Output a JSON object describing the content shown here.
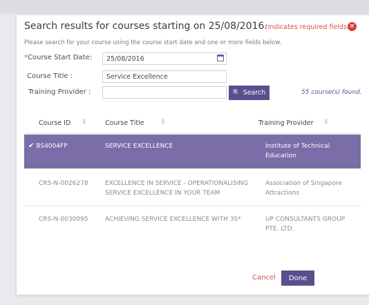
{
  "dialog": {
    "title": "Search results for courses starting on 25/08/2016.",
    "required_note": "*indicates required fields.",
    "close_icon": "✕",
    "instructions": "Please search for your course using the course start date and one or more fields below."
  },
  "form": {
    "start_date_star": "*",
    "start_date_label": "Course Start Date:",
    "start_date_value": "25/08/2016",
    "course_title_label": "Course Title :",
    "course_title_value": "Service Excellence",
    "provider_label": "Training Provider :",
    "provider_value": "",
    "search_label": "Search",
    "search_icon": "🔍",
    "found_text": "55 course(s) found."
  },
  "table": {
    "headers": [
      "Course ID",
      "Course Title",
      "Training Provider"
    ],
    "sort_icon": "⇕",
    "rows": [
      {
        "id": "BS4004FP",
        "title": "SERVICE EXCELLENCE",
        "provider": "Institute of Technical Education",
        "selected": true
      },
      {
        "id": "CRS-N-0026278",
        "title": "EXCELLENCE IN SERVICE - OPERATIONALISING SERVICE EXCELLENCE IN YOUR TEAM",
        "provider": "Association of Singapore Attractions",
        "selected": false
      },
      {
        "id": "CRS-N-0030095",
        "title": "ACHIEVING SERVICE EXCELLENCE WITH 3S*",
        "provider": "UP CONSULTANTS GROUP PTE. LTD.",
        "selected": false
      }
    ]
  },
  "actions": {
    "cancel_label": "Cancel",
    "done_label": "Done"
  },
  "colors": {
    "accent": "#5b4e8f",
    "selected_row": "#7a6da8",
    "required": "#d94b4b"
  }
}
